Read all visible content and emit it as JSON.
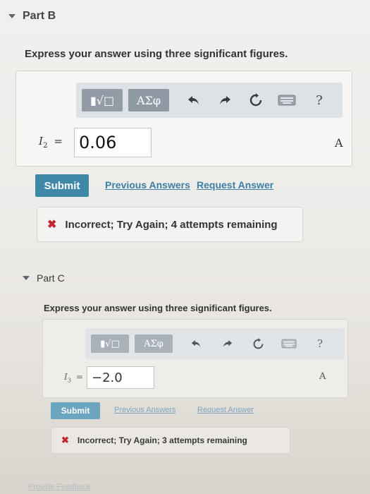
{
  "part_b": {
    "title": "Part B",
    "instructions": "Express your answer using three significant figures.",
    "toolbar": {
      "templates_label": "▮√□",
      "symbols_label": "ΑΣφ",
      "undo_icon": "undo-icon",
      "redo_icon": "redo-icon",
      "reset_icon": "reset-icon",
      "keyboard_icon": "keyboard-icon",
      "help_label": "?"
    },
    "variable": "I",
    "variable_sub": "2",
    "equals": "=",
    "answer_value": "0.06",
    "unit": "A",
    "submit_label": "Submit",
    "previous_answers_label": "Previous Answers",
    "request_answer_label": "Request Answer",
    "feedback_mark": "✖",
    "feedback_text": "Incorrect; Try Again; 4 attempts remaining"
  },
  "part_c": {
    "title": "Part C",
    "instructions": "Express your answer using three significant figures.",
    "toolbar": {
      "templates_label": "▮√□",
      "symbols_label": "ΑΣφ",
      "undo_icon": "undo-icon",
      "redo_icon": "redo-icon",
      "reset_icon": "reset-icon",
      "keyboard_icon": "keyboard-icon",
      "help_label": "?"
    },
    "variable": "I",
    "variable_sub": "3",
    "equals": "=",
    "answer_value": "−2.0",
    "unit": "A",
    "submit_label": "Submit",
    "previous_answers_label": "Previous Answers",
    "request_answer_label": "Request Answer",
    "feedback_mark": "✖",
    "feedback_text": "Incorrect; Try Again; 3 attempts remaining"
  },
  "footer": {
    "link_text": "Provide Feedback"
  },
  "colors": {
    "accent": "#3f89a8",
    "link": "#3d7fa5",
    "error": "#c3262c",
    "toolbar": "#dde2e7"
  }
}
